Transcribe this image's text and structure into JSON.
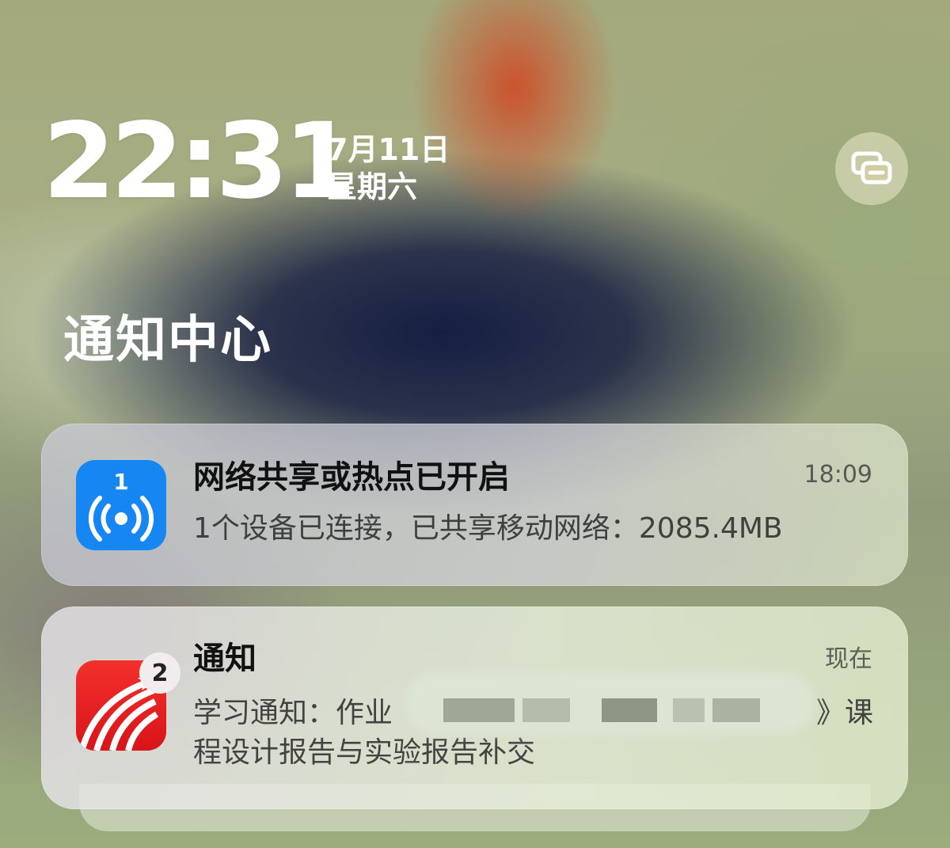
{
  "lockscreen": {
    "time": "22:31",
    "date": "7月11日",
    "weekday": "星期六"
  },
  "notification_center": {
    "title": "通知中心"
  },
  "notifications": [
    {
      "app_icon": "hotspot-icon",
      "icon_count": "1",
      "title": "网络共享或热点已开启",
      "time": "18:09",
      "body": "1个设备已连接，已共享移动网络：2085.4MB",
      "icon_color": "#1686f2"
    },
    {
      "app_icon": "xuexitong-app-icon",
      "badge": "2",
      "title": "通知",
      "time": "现在",
      "body_visible_start": "学习通知：作业",
      "body_visible_end": "》课",
      "body_line2": "程设计报告与实验报告补交",
      "icon_color": "#e2201f"
    }
  ]
}
